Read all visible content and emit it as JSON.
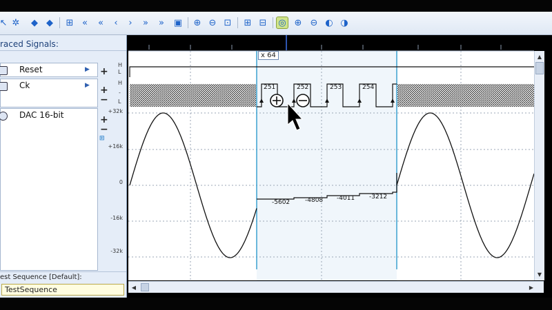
{
  "toolbar": {
    "icons": [
      "pointer-icon",
      "gear-icon",
      "arrow-left-icon",
      "arrow-right-icon",
      "settings-icon",
      "rewind-fast-icon",
      "rewind-icon",
      "step-back-icon",
      "step-forward-icon",
      "forward-icon",
      "forward-fast-icon",
      "insert-icon",
      "zoom-fit-icon",
      "zoom-out-area-icon",
      "zoom-area-icon",
      "copy-marker-icon",
      "paste-marker-icon",
      "zoom-active-icon",
      "zoom-in-icon",
      "zoom-out-icon",
      "zoom-prev-icon",
      "zoom-next-icon"
    ]
  },
  "left_panel": {
    "title": "raced Signals:",
    "signals": [
      {
        "name": "Reset",
        "hl_top": "H",
        "hl_bottom": "L"
      },
      {
        "name": "Ck",
        "hl_top": "H",
        "hl_bottom": "L",
        "hl_mid": "-"
      },
      {
        "name": "DAC 16-bit"
      }
    ],
    "y_axis": [
      "+32k",
      "+16k",
      "0",
      "-16k",
      "-32k"
    ],
    "sequence_label": "est Sequence [Default]:",
    "sequence_value": "TestSequence"
  },
  "wave": {
    "zoom_label": "x 64",
    "ck_cycles": [
      "251",
      "252",
      "253",
      "254"
    ],
    "dac_values": [
      "-5602",
      "-4808",
      "-4011",
      "-3212"
    ],
    "cursor_plus": "+",
    "cursor_minus": "−"
  },
  "colors": {
    "accent": "#1e63c9",
    "panel": "#e5edf8",
    "wave": "#111111",
    "cursor": "#3aa0d0"
  }
}
